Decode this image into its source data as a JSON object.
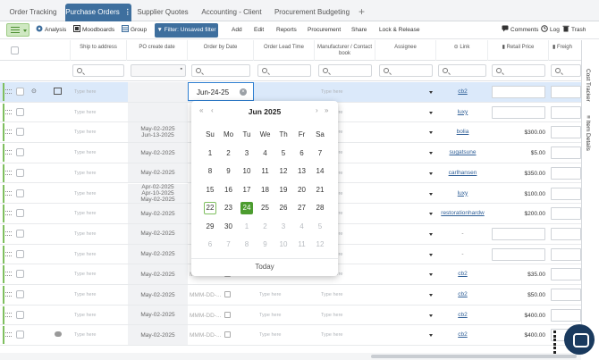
{
  "tabs": [
    {
      "label": "Order Tracking",
      "active": false
    },
    {
      "label": "Purchase Orders",
      "active": true
    },
    {
      "label": "Supplier Quotes",
      "active": false
    },
    {
      "label": "Accounting - Client",
      "active": false
    },
    {
      "label": "Procurement Budgeting",
      "active": false
    }
  ],
  "tab_add": "+",
  "tab_more": "⋮",
  "toolbar": {
    "analysis": "Analysis",
    "moodboards": "Moodboards",
    "group": "Group",
    "filter": "Filter: Unsaved filter",
    "add": "Add",
    "edit": "Edit",
    "reports": "Reports",
    "procurement": "Procurement",
    "share": "Share",
    "lock_release": "Lock & Release",
    "comments": "Comments",
    "log": "Log",
    "trash": "Trash"
  },
  "columns": {
    "ship_to": "Ship to address",
    "po_create": "PO create date",
    "order_by": "Order by Date",
    "lead_time": "Order Lead Time",
    "manufacturer": "Manufacturer / Contact book",
    "assignee": "Assignee",
    "link": "Link",
    "retail": "Retail Price",
    "freight": "Freigh"
  },
  "placeholder": "Type here",
  "date_placeholder": "MMM-DD-...",
  "rows": [
    {
      "po": [
        ""
      ],
      "link": "cb2",
      "price": ""
    },
    {
      "po": [
        ""
      ],
      "link": "luxy",
      "price": ""
    },
    {
      "po": [
        "May-02-2025",
        "Jun-13-2025"
      ],
      "link": "bolia",
      "price": "$300.00"
    },
    {
      "po": [
        "May-02-2025"
      ],
      "link": "sugatsune",
      "price": "$5.00"
    },
    {
      "po": [
        "May-02-2025"
      ],
      "link": "carlhansen",
      "price": "$350.00"
    },
    {
      "po": [
        "Apr-02-2025",
        "Apr-10-2025",
        "May-02-2025"
      ],
      "link": "luxy",
      "price": "$100.00"
    },
    {
      "po": [
        "May-02-2025"
      ],
      "link": "restorationhardw",
      "price": "$200.00"
    },
    {
      "po": [
        "May-02-2025"
      ],
      "link": "-",
      "price": ""
    },
    {
      "po": [
        "May-02-2025"
      ],
      "link": "-",
      "price": ""
    },
    {
      "po": [
        "May-02-2025"
      ],
      "link": "cb2",
      "price": "$35.00"
    },
    {
      "po": [
        "May-02-2025"
      ],
      "link": "cb2",
      "price": "$50.00"
    },
    {
      "po": [
        "May-02-2025"
      ],
      "link": "cb2",
      "price": "$400.00"
    },
    {
      "po": [
        "May-02-2025"
      ],
      "link": "cb2",
      "price": "$400.00"
    }
  ],
  "active_date_value": "Jun-24-25",
  "calendar": {
    "month": "Jun",
    "year": "2025",
    "weekdays": [
      "Su",
      "Mo",
      "Tu",
      "We",
      "Th",
      "Fr",
      "Sa"
    ],
    "weeks": [
      [
        "1",
        "2",
        "3",
        "4",
        "5",
        "6",
        "7"
      ],
      [
        "8",
        "9",
        "10",
        "11",
        "12",
        "13",
        "14"
      ],
      [
        "15",
        "16",
        "17",
        "18",
        "19",
        "20",
        "21"
      ],
      [
        "22",
        "23",
        "24",
        "25",
        "26",
        "27",
        "28"
      ],
      [
        "29",
        "30",
        "1",
        "2",
        "3",
        "4",
        "5"
      ],
      [
        "6",
        "7",
        "8",
        "9",
        "10",
        "11",
        "12"
      ]
    ],
    "today_day": "22",
    "selected_day": "24",
    "today_label": "Today",
    "nav_prev_year": "«",
    "nav_prev_month": "‹",
    "nav_next_month": "›",
    "nav_next_year": "»"
  },
  "side_panel": {
    "cost_tracker": "Cost Tracker",
    "item_details": "Item Details"
  },
  "colors": {
    "accent_blue": "#3e6f9e",
    "accent_green": "#4c9c2f",
    "selected_row": "#dbe9fa"
  }
}
